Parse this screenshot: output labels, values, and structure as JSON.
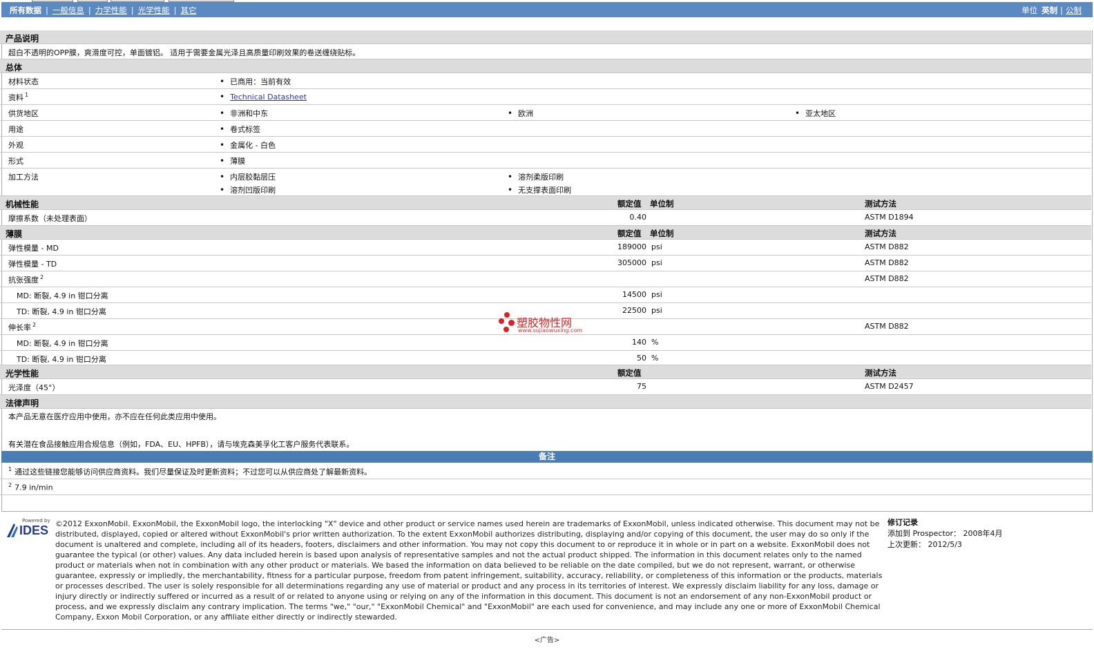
{
  "nav": {
    "tabs": [
      "所有数据",
      "一般信息",
      "力学性能",
      "光学性能",
      "其它"
    ],
    "unit_label": "单位",
    "unit_english": "英制",
    "unit_metric": "公制"
  },
  "product_description": {
    "title": "产品说明",
    "text": "超白不透明的OPP膜，爽滑度可控，单面镀铝。 适用于需要金属光泽且高质量印刷效果的卷送缠绕贴标。"
  },
  "general": {
    "title": "总体",
    "material_status": {
      "label": "材料状态",
      "values": [
        "已商用：当前有效"
      ]
    },
    "resources": {
      "label": "资料",
      "sup": "1",
      "link": "Technical Datasheet"
    },
    "supply_region": {
      "label": "供货地区",
      "values": [
        "非洲和中东",
        "欧洲",
        "亚太地区"
      ]
    },
    "usage": {
      "label": "用途",
      "values": [
        "卷式标签"
      ]
    },
    "appearance": {
      "label": "外观",
      "values": [
        "金属化 - 白色"
      ]
    },
    "form": {
      "label": "形式",
      "values": [
        "薄膜"
      ]
    },
    "processing": {
      "label": "加工方法",
      "values": [
        "内层胶黏层压",
        "溶剂柔版印刷",
        "溶剂凹版印刷",
        "无支撑表面印刷"
      ]
    }
  },
  "mechanical": {
    "title": "机械性能",
    "col_value": "额定值",
    "col_unit": "单位制",
    "col_method": "测试方法",
    "rows": [
      {
        "label": "摩擦系数（未处理表面）",
        "value": "0.40",
        "unit": "",
        "method": "ASTM D1894"
      }
    ]
  },
  "film": {
    "title": "薄膜",
    "col_value": "额定值",
    "col_unit": "单位制",
    "col_method": "测试方法",
    "rows": [
      {
        "label": "弹性模量 - MD",
        "value": "189000",
        "unit": "psi",
        "method": "ASTM D882"
      },
      {
        "label": "弹性模量 - TD",
        "value": "305000",
        "unit": "psi",
        "method": "ASTM D882"
      },
      {
        "label": "抗张强度",
        "sup": "2",
        "value": "",
        "unit": "",
        "method": "ASTM D882"
      },
      {
        "label": "MD: 断裂, 4.9 in 钳口分离",
        "value": "14500",
        "unit": "psi",
        "method": ""
      },
      {
        "label": "TD: 断裂, 4.9 in 钳口分离",
        "value": "22500",
        "unit": "psi",
        "method": ""
      },
      {
        "label": "伸长率",
        "sup": "2",
        "value": "",
        "unit": "",
        "method": "ASTM D882"
      },
      {
        "label": "MD: 断裂, 4.9 in 钳口分离",
        "value": "140",
        "unit": "%",
        "method": ""
      },
      {
        "label": "TD: 断裂, 4.9 in 钳口分离",
        "value": "50",
        "unit": "%",
        "method": ""
      }
    ]
  },
  "optical": {
    "title": "光学性能",
    "col_value": "额定值",
    "col_method": "测试方法",
    "rows": [
      {
        "label": "光泽度（45°）",
        "value": "75",
        "method": "ASTM D2457"
      }
    ]
  },
  "legal": {
    "title": "法律声明",
    "line1": "本产品无意在医疗应用中使用，亦不应在任何此类应用中使用。",
    "line2": "有关潜在食品接触应用合规信息（例如，FDA、EU、HPFB），请与埃克森美孚化工客户服务代表联系。"
  },
  "notes": {
    "title": "备注",
    "items": [
      {
        "sup": "1",
        "text": "通过这些链接您能够访问供应商资料。我们尽量保证及时更新资料；不过您可以从供应商处了解最新资料。"
      },
      {
        "sup": "2",
        "text": "7.9 in/min"
      }
    ]
  },
  "watermark": {
    "text": "塑胶物性网",
    "url": "www.sujiaowuxing.com"
  },
  "footer": {
    "logo_powered": "Powered by",
    "logo_name": "IDES",
    "legal_text": "©2012 ExxonMobil. ExxonMobil, the ExxonMobil logo, the interlocking \"X\" device and other product or service names used herein are trademarks of ExxonMobil, unless indicated otherwise. This document may not be distributed, displayed, copied or altered without ExxonMobil's prior written authorization. To the extent ExxonMobil authorizes distributing, displaying and/or copying of this document, the user may do so only if the document is unaltered and complete, including all of its headers, footers, disclaimers and other information. You may not copy this document to or reproduce it in whole or in part on a website. ExxonMobil does not guarantee the typical (or other) values. Any data included herein is based upon analysis of representative samples and not the actual product shipped. The information in this document relates only to the named product or materials when not in combination with any other product or materials. We based the information on data believed to be reliable on the date compiled, but we do not represent, warrant, or otherwise guarantee, expressly or impliedly, the merchantability, fitness for a particular purpose, freedom from patent infringement, suitability, accuracy, reliability, or completeness of this information or the products, materials or processes described. The user is solely responsible for all determinations regarding any use of material or product and any process in its territories of interest. We expressly disclaim liability for any loss, damage or injury directly or indirectly suffered or incurred as a result of or related to anyone using or relying on any of the information in this document. This document is not an endorsement of any non-ExxonMobil product or process, and we expressly disclaim any contrary implication. The terms \"we,\" \"our,\" \"ExxonMobil Chemical\" and \"ExxonMobil\" are each used for convenience, and may include any one or more of ExxonMobil Chemical Company, Exxon Mobil Corporation, or any affiliate either directly or indirectly stewarded.",
    "revision_title": "修订记录",
    "added_label": "添加到 Prospector：",
    "added_value": "2008年4月",
    "updated_label": "上次更新：",
    "updated_value": "2012/5/3"
  },
  "ad_label": "<广告>"
}
